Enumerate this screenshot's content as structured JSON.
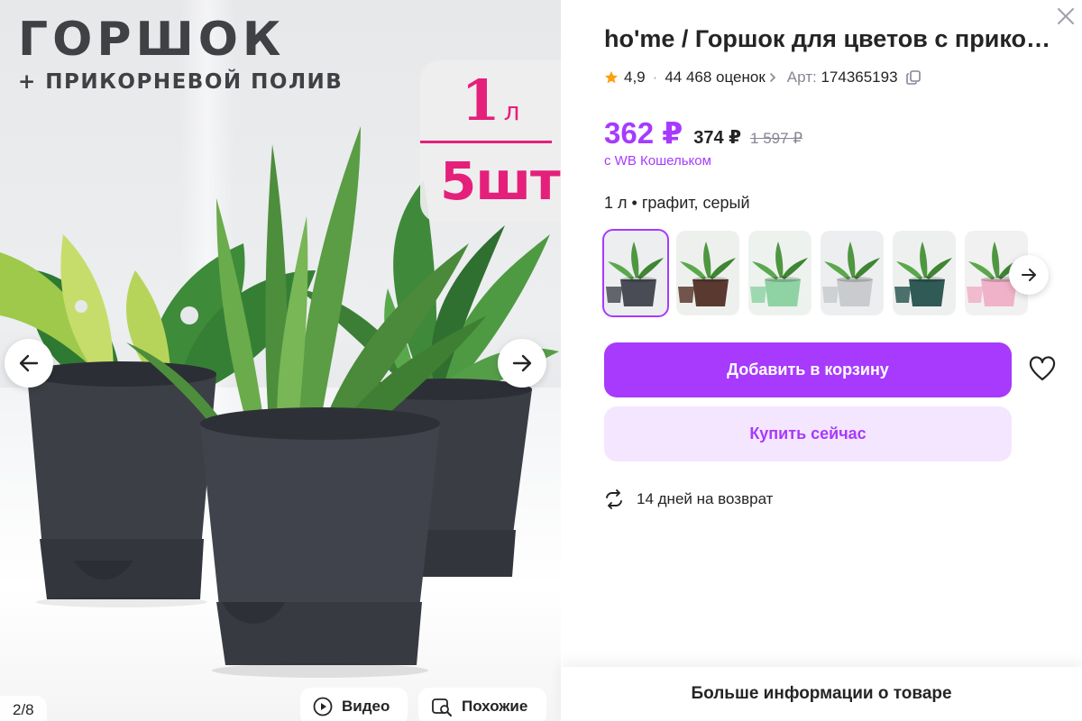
{
  "gallery": {
    "promo_title": "ГОРШОК",
    "promo_subtitle": "+ ПРИКОРНЕВОЙ ПОЛИВ",
    "badge_volume": "1",
    "badge_volume_unit": "л",
    "badge_quantity": "5шт",
    "counter": "2/8",
    "video_label": "Видео",
    "similar_label": "Похожие",
    "icons": {
      "prev": "arrow-left-icon",
      "next": "arrow-right-icon",
      "video": "play-icon",
      "similar": "image-search-icon"
    }
  },
  "product": {
    "title": "ho'me / Горшок для цветов с прикорневым поливом",
    "rating": "4,9",
    "reviews": "44 468 оценок",
    "article_label": "Арт:",
    "article": "174365193",
    "price": "362 ₽",
    "price_old": "374 ₽",
    "price_crossed": "1 597 ₽",
    "wallet_note": "с WB Кошельком",
    "variant": "1 л • графит, серый",
    "thumbnails": [
      {
        "color": "графит",
        "pot_color": "#4a4c55",
        "bg": "#eceef0"
      },
      {
        "color": "коричневый",
        "pot_color": "#5a3a30",
        "bg": "#eef0ee"
      },
      {
        "color": "зеленый",
        "pot_color": "#8fd3a4",
        "bg": "#eef2ee"
      },
      {
        "color": "серый",
        "pot_color": "#c9cbce",
        "bg": "#eceef0"
      },
      {
        "color": "изумрудный",
        "pot_color": "#2f5a55",
        "bg": "#eef0ef"
      },
      {
        "color": "розовый",
        "pot_color": "#f0b2c8",
        "bg": "#f1f1f1"
      }
    ],
    "add_to_cart": "Добавить в корзину",
    "buy_now": "Купить сейчас",
    "returns": "14 дней на возврат",
    "more_info": "Больше информации о товаре"
  },
  "colors": {
    "accent": "#a73afd",
    "accent_light": "#f4e6fe",
    "badge_pink": "#e5207a",
    "star": "#ff9f0a"
  }
}
